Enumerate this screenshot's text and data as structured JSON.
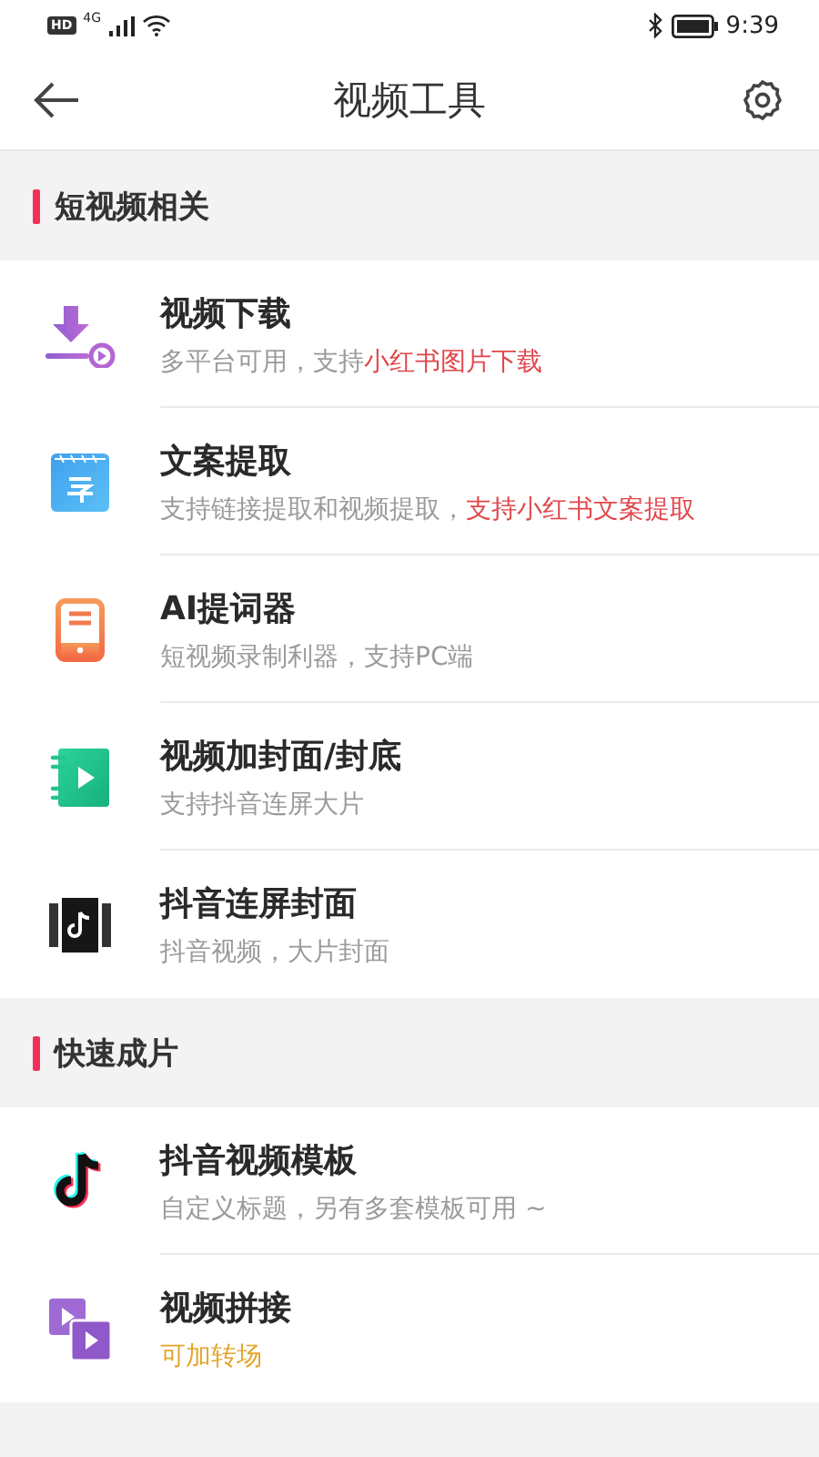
{
  "status_bar": {
    "hd": "HD",
    "network": "4G",
    "time": "9:39"
  },
  "header": {
    "title": "视频工具"
  },
  "sections": [
    {
      "title": "短视频相关",
      "items": [
        {
          "kind": "download",
          "title": "视频下载",
          "subtitle": [
            {
              "text": "多平台可用，支持",
              "kind": "plain"
            },
            {
              "text": "小红书图片下载",
              "kind": "accent"
            }
          ]
        },
        {
          "kind": "caption",
          "title": "文案提取",
          "subtitle": [
            {
              "text": "支持链接提取和视频提取，",
              "kind": "plain"
            },
            {
              "text": "支持小红书文案提取",
              "kind": "accent"
            }
          ]
        },
        {
          "kind": "prompter",
          "title": "AI提词器",
          "subtitle": [
            {
              "text": "短视频录制利器，支持PC端",
              "kind": "plain"
            }
          ]
        },
        {
          "kind": "cover",
          "title": "视频加封面/封底",
          "subtitle": [
            {
              "text": "支持抖音连屏大片",
              "kind": "plain"
            }
          ]
        },
        {
          "kind": "panorama",
          "title": "抖音连屏封面",
          "subtitle": [
            {
              "text": "抖音视频，大片封面",
              "kind": "plain"
            }
          ]
        }
      ]
    },
    {
      "title": "快速成片",
      "items": [
        {
          "kind": "note",
          "title": "抖音视频模板",
          "subtitle": [
            {
              "text": "自定义标题，另有多套模板可用 ~",
              "kind": "plain"
            }
          ]
        },
        {
          "kind": "merge",
          "title": "视频拼接",
          "subtitle": [
            {
              "text": "可加转场",
              "kind": "warning"
            }
          ]
        }
      ]
    }
  ]
}
